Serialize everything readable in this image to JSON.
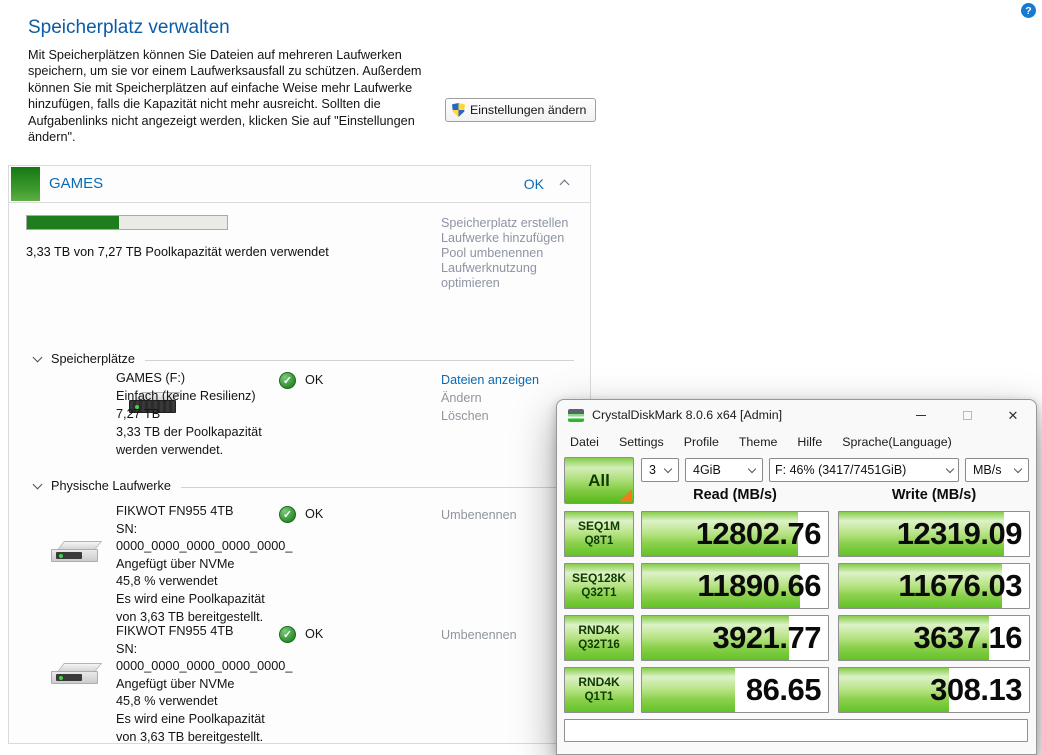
{
  "header": {
    "title": "Speicherplatz verwalten",
    "description": "Mit Speicherplätzen können Sie Dateien auf mehreren Laufwerken speichern, um sie vor einem Laufwerksausfall zu schützen. Außerdem können Sie mit Speicherplätzen auf einfache Weise mehr Laufwerke hinzufügen, falls die Kapazität nicht mehr ausreicht. Sollten die Aufgabenlinks nicht angezeigt werden, klicken Sie auf \"Einstellungen ändern\".",
    "change_settings_label": "Einstellungen ändern",
    "help_label": "?"
  },
  "pool": {
    "name": "GAMES",
    "status": "OK",
    "usage_pct": 46,
    "usage_caption": "3,33 TB von 7,27 TB Poolkapazität werden verwendet",
    "actions": [
      "Speicherplatz erstellen",
      "Laufwerke hinzufügen",
      "Pool umbenennen",
      "Laufwerknutzung optimieren"
    ]
  },
  "storage_spaces": {
    "section_label": "Speicherplätze",
    "item": {
      "lines": [
        "GAMES (F:)",
        "Einfach (keine Resilienz)",
        "7,27 TB",
        "3,33 TB der Poolkapazität",
        "werden verwendet."
      ],
      "status": "OK",
      "check_glyph": "✓",
      "links": [
        "Dateien anzeigen",
        "Ändern",
        "Löschen"
      ]
    }
  },
  "physical": {
    "section_label": "Physische Laufwerke",
    "items": [
      {
        "lines": [
          "FIKWOT FN955 4TB",
          "SN:",
          "0000_0000_0000_0000_0000_",
          "Angefügt über NVMe",
          "45,8 % verwendet",
          "Es wird eine Poolkapazität",
          "von 3,63 TB bereitgestellt."
        ],
        "status": "OK",
        "action": "Umbenennen"
      },
      {
        "lines": [
          "FIKWOT FN955 4TB",
          "SN:",
          "0000_0000_0000_0000_0000_",
          "Angefügt über NVMe",
          "45,8 % verwendet",
          "Es wird eine Poolkapazität",
          "von 3,63 TB bereitgestellt."
        ],
        "status": "OK",
        "action": "Umbenennen"
      }
    ]
  },
  "cdm": {
    "title": "CrystalDiskMark 8.0.6 x64 [Admin]",
    "menu": [
      "Datei",
      "Settings",
      "Profile",
      "Theme",
      "Hilfe",
      "Sprache(Language)"
    ],
    "all_label": "All",
    "test_count": "3",
    "test_size": "4GiB",
    "target": "F: 46% (3417/7451GiB)",
    "unit": "MB/s",
    "read_header": "Read (MB/s)",
    "write_header": "Write (MB/s)",
    "close_glyph": "✕",
    "rows": [
      {
        "name": "SEQ1M",
        "queue": "Q8T1",
        "read": "12802.76",
        "write": "12319.09",
        "read_fill": 84,
        "write_fill": 87
      },
      {
        "name": "SEQ128K",
        "queue": "Q32T1",
        "read": "11890.66",
        "write": "11676.03",
        "read_fill": 85,
        "write_fill": 86
      },
      {
        "name": "RND4K",
        "queue": "Q32T16",
        "read": "3921.77",
        "write": "3637.16",
        "read_fill": 79,
        "write_fill": 79
      },
      {
        "name": "RND4K",
        "queue": "Q1T1",
        "read": "86.65",
        "write": "308.13",
        "read_fill": 50,
        "write_fill": 58
      }
    ],
    "comment": ""
  },
  "colors": {
    "accent_blue": "#0a6ab4",
    "bar_green": "#62c226",
    "progress_green": "#1e7e1e",
    "status_green": "#2f8f2f",
    "muted_link_gray": "#90959e"
  }
}
